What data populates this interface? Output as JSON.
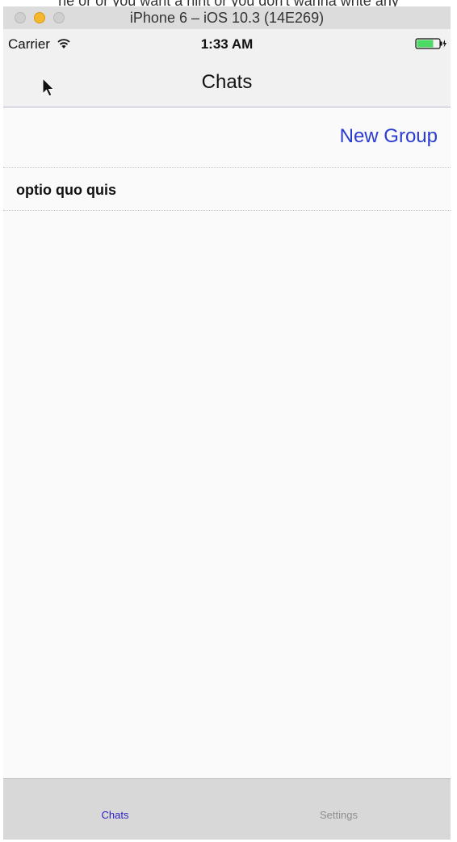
{
  "window": {
    "title": "iPhone 6 – iOS 10.3 (14E269)",
    "clipped_text": "ne or or you want a hint or you don't wanna write any"
  },
  "status_bar": {
    "carrier": "Carrier",
    "time": "1:33 AM",
    "icons": [
      "wifi-icon",
      "battery-charging-icon"
    ]
  },
  "nav": {
    "title": "Chats"
  },
  "actions": {
    "new_group": "New Group"
  },
  "chats": [
    {
      "name": "optio quo quis"
    }
  ],
  "tab_bar": {
    "tabs": [
      {
        "label": "Chats",
        "active": true
      },
      {
        "label": "Settings",
        "active": false
      }
    ]
  },
  "colors": {
    "accent": "#2b3bd1",
    "tab_active": "#2b1fc4",
    "tab_inactive": "#8e8e8e",
    "battery": "#4cd964"
  }
}
